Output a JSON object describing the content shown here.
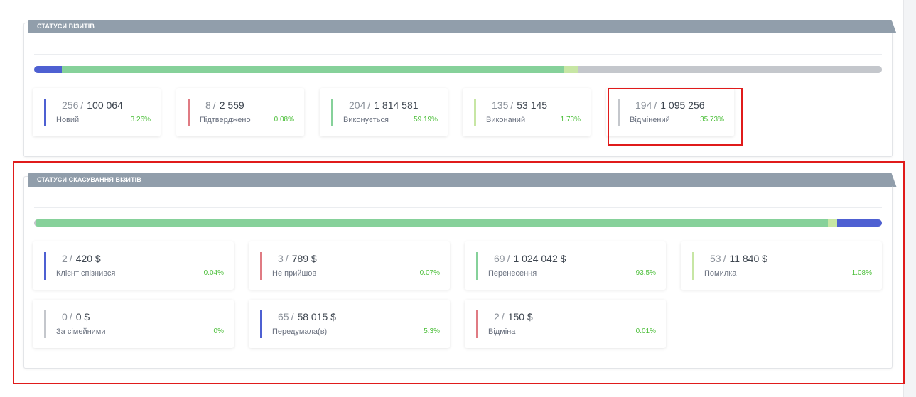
{
  "visits": {
    "title": "СТАТУСИ ВІЗИТІВ",
    "bar": [
      {
        "color": "#4e60d2",
        "share": 3.26
      },
      {
        "color": "#86d19a",
        "share": 59.19
      },
      {
        "color": "#c7e6a4",
        "share": 1.73
      },
      {
        "color": "#c4c7cc",
        "share": 35.73
      }
    ],
    "cards": [
      {
        "count": "256",
        "amount": "100 064",
        "label": "Новий",
        "pct": "3.26%",
        "color": "#4e60d2"
      },
      {
        "count": "8",
        "amount": "2 559",
        "label": "Підтверджено",
        "pct": "0.08%",
        "color": "#e07b83"
      },
      {
        "count": "204",
        "amount": "1 814 581",
        "label": "Виконується",
        "pct": "59.19%",
        "color": "#86d19a"
      },
      {
        "count": "135",
        "amount": "53 145",
        "label": "Виконаний",
        "pct": "1.73%",
        "color": "#c7e6a4"
      },
      {
        "count": "194",
        "amount": "1 095 256",
        "label": "Відмінений",
        "pct": "35.73%",
        "color": "#c4c7cc"
      }
    ]
  },
  "cancellations": {
    "title": "СТАТУСИ СКАСУВАННЯ ВІЗИТІВ",
    "bar": [
      {
        "color": "#c4c7cc",
        "share": 0.2
      },
      {
        "color": "#86d19a",
        "share": 93.5
      },
      {
        "color": "#c7e6a4",
        "share": 1.08
      },
      {
        "color": "#4e60d2",
        "share": 5.3
      }
    ],
    "cards": [
      {
        "count": "2",
        "amount": "420 $",
        "label": "Клієнт спізнився",
        "pct": "0.04%",
        "color": "#4e60d2"
      },
      {
        "count": "3",
        "amount": "789 $",
        "label": "Не прийшов",
        "pct": "0.07%",
        "color": "#e07b83"
      },
      {
        "count": "69",
        "amount": "1 024 042 $",
        "label": "Перенесення",
        "pct": "93.5%",
        "color": "#86d19a"
      },
      {
        "count": "53",
        "amount": "11 840 $",
        "label": "Помилка",
        "pct": "1.08%",
        "color": "#c7e6a4"
      },
      {
        "count": "0",
        "amount": "0 $",
        "label": "За сімейними",
        "pct": "0%",
        "color": "#c4c7cc"
      },
      {
        "count": "65",
        "amount": "58 015 $",
        "label": "Передумала(в)",
        "pct": "5.3%",
        "color": "#4e60d2"
      },
      {
        "count": "2",
        "amount": "150 $",
        "label": "Відміна",
        "pct": "0.01%",
        "color": "#e07b83"
      }
    ]
  }
}
